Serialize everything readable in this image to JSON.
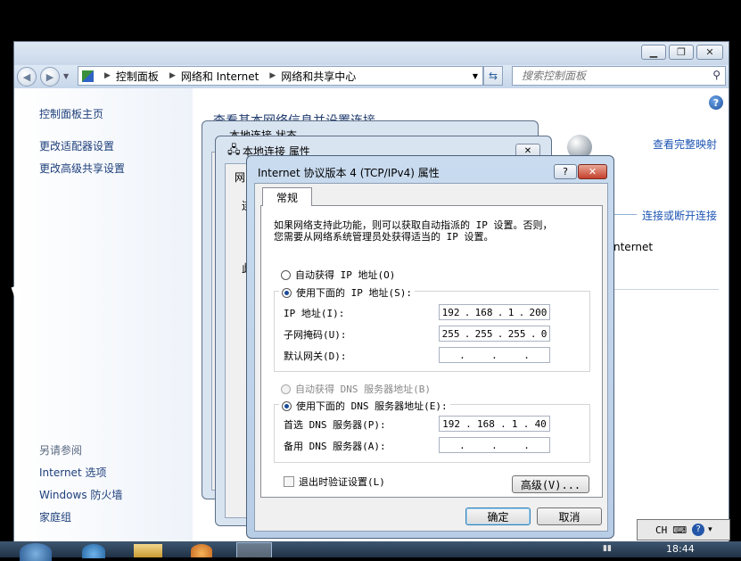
{
  "explorer": {
    "breadcrumbs": [
      "控制面板",
      "网络和 Internet",
      "网络和共享中心"
    ],
    "search_placeholder": "搜索控制面板",
    "sidebar": {
      "main_link": "控制面板主页",
      "links": [
        "更改适配器设置",
        "更改高级共享设置"
      ],
      "see_also_heading": "另请参阅",
      "see_also_links": [
        "Internet 选项",
        "Windows 防火墙",
        "家庭组"
      ]
    },
    "main_heading": "查看基本网络信息并设置连接",
    "right_links": {
      "view_full_map": "查看完整映射",
      "connect_disconnect": "连接或断开连接"
    },
    "internet_text": "nternet"
  },
  "back_dialog_1": {
    "title": "本地连接 状态"
  },
  "back_dialog_2": {
    "title": "本地连接 属性",
    "fragments": [
      "网",
      "连",
      "此"
    ]
  },
  "tcp_dialog": {
    "title": "Internet 协议版本 4 (TCP/IPv4) 属性",
    "help_label": "?",
    "close_label": "✕",
    "tab_label": "常规",
    "description_line1": "如果网络支持此功能，则可以获取自动指派的 IP 设置。否则，",
    "description_line2": "您需要从网络系统管理员处获得适当的 IP 设置。",
    "ip_auto_label": "自动获得 IP 地址(O)",
    "ip_manual_label": "使用下面的 IP 地址(S):",
    "ip_address_label": "IP 地址(I):",
    "ip_address": [
      "192",
      "168",
      "1",
      "200"
    ],
    "subnet_label": "子网掩码(U):",
    "subnet_mask": [
      "255",
      "255",
      "255",
      "0"
    ],
    "gateway_label": "默认网关(D):",
    "gateway": [
      "",
      "",
      "",
      ""
    ],
    "dns_auto_label": "自动获得 DNS 服务器地址(B)",
    "dns_manual_label": "使用下面的 DNS 服务器地址(E):",
    "preferred_dns_label": "首选 DNS 服务器(P):",
    "preferred_dns": [
      "192",
      "168",
      "1",
      "40"
    ],
    "alternate_dns_label": "备用 DNS 服务器(A):",
    "alternate_dns": [
      "",
      "",
      "",
      ""
    ],
    "validate_label": "退出时验证设置(L)",
    "validate_checked": false,
    "advanced_label": "高级(V)...",
    "ok_label": "确定",
    "cancel_label": "取消"
  },
  "taskbar": {
    "lang": "CH",
    "time": "18:44"
  }
}
